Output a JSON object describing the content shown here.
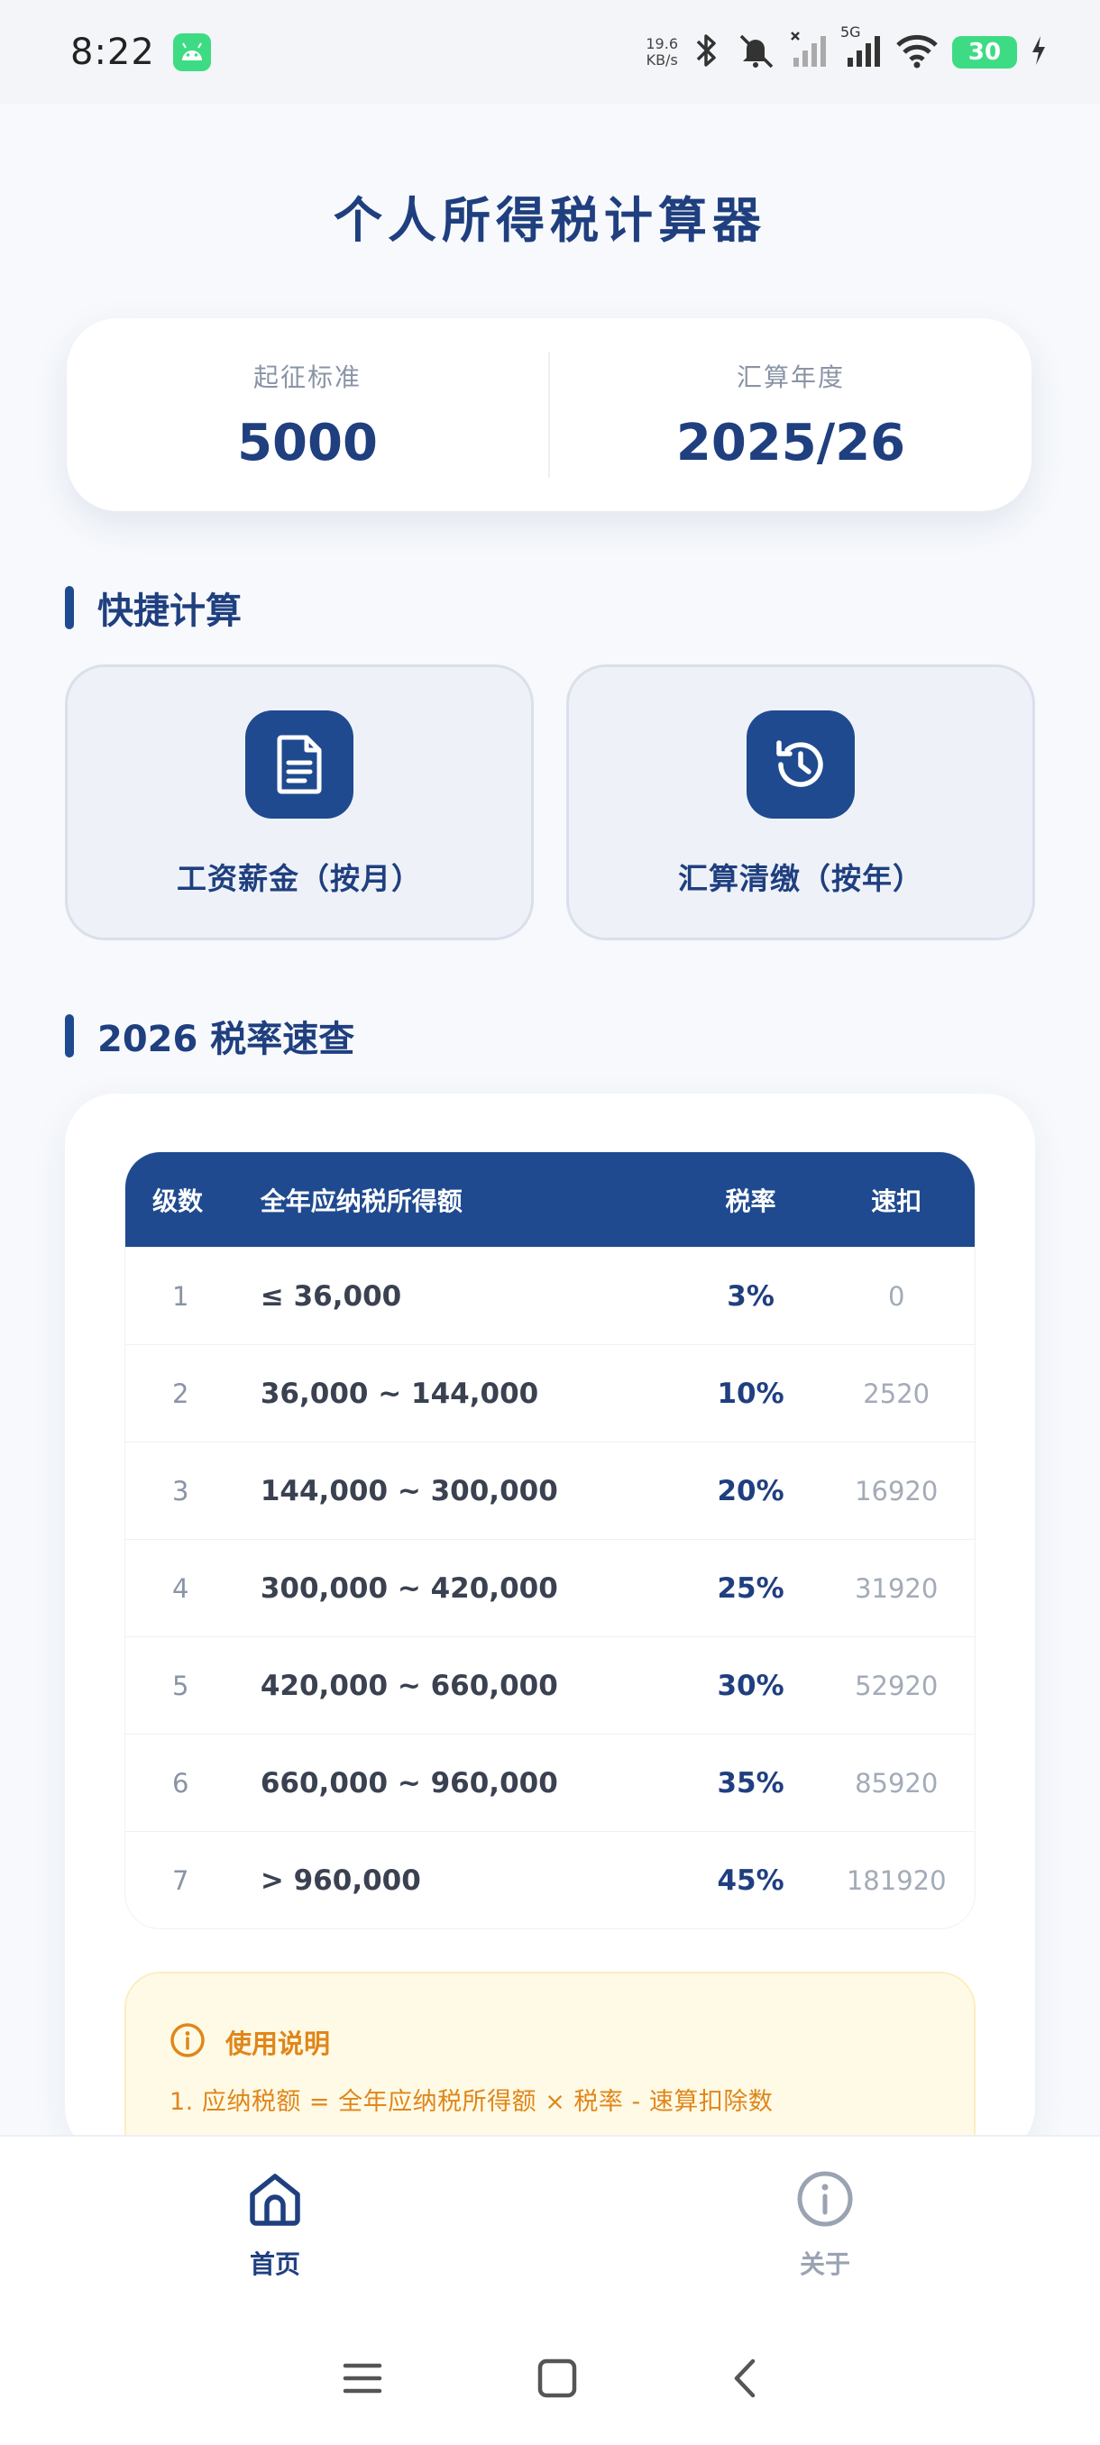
{
  "status_bar": {
    "time": "8:22",
    "speed_value": "19.6",
    "speed_unit": "KB/s",
    "network": "5G",
    "battery": "30"
  },
  "page": {
    "title": "个人所得税计算器"
  },
  "info_card": {
    "threshold_label": "起征标准",
    "threshold_value": "5000",
    "year_label": "汇算年度",
    "year_value": "2025/26"
  },
  "quick_section": {
    "title": "快捷计算",
    "salary_label": "工资薪金（按月）",
    "salary_icon": "document-icon",
    "annual_label": "汇算清缴（按年）",
    "annual_icon": "history-icon"
  },
  "rate_section": {
    "title": "2026 税率速查",
    "headers": {
      "level": "级数",
      "range": "全年应纳税所得额",
      "rate": "税率",
      "quick": "速扣"
    },
    "rows": [
      {
        "level": "1",
        "range": "≤ 36,000",
        "rate": "3%",
        "quick": "0"
      },
      {
        "level": "2",
        "range": "36,000 ~ 144,000",
        "rate": "10%",
        "quick": "2520"
      },
      {
        "level": "3",
        "range": "144,000 ~ 300,000",
        "rate": "20%",
        "quick": "16920"
      },
      {
        "level": "4",
        "range": "300,000 ~ 420,000",
        "rate": "25%",
        "quick": "31920"
      },
      {
        "level": "5",
        "range": "420,000 ~ 660,000",
        "rate": "30%",
        "quick": "52920"
      },
      {
        "level": "6",
        "range": "660,000 ~ 960,000",
        "rate": "35%",
        "quick": "85920"
      },
      {
        "level": "7",
        "range": "> 960,000",
        "rate": "45%",
        "quick": "181920"
      }
    ]
  },
  "note": {
    "title": "使用说明",
    "line1": "1. 应纳税额 = 全年应纳税所得额 × 税率 - 速算扣除数"
  },
  "bottom_nav": {
    "home_label": "首页",
    "about_label": "关于"
  },
  "colors": {
    "primary": "#1f4a8f",
    "title_text": "#1f3f7f",
    "note_accent": "#e0861a",
    "note_bg": "#fffae6"
  }
}
